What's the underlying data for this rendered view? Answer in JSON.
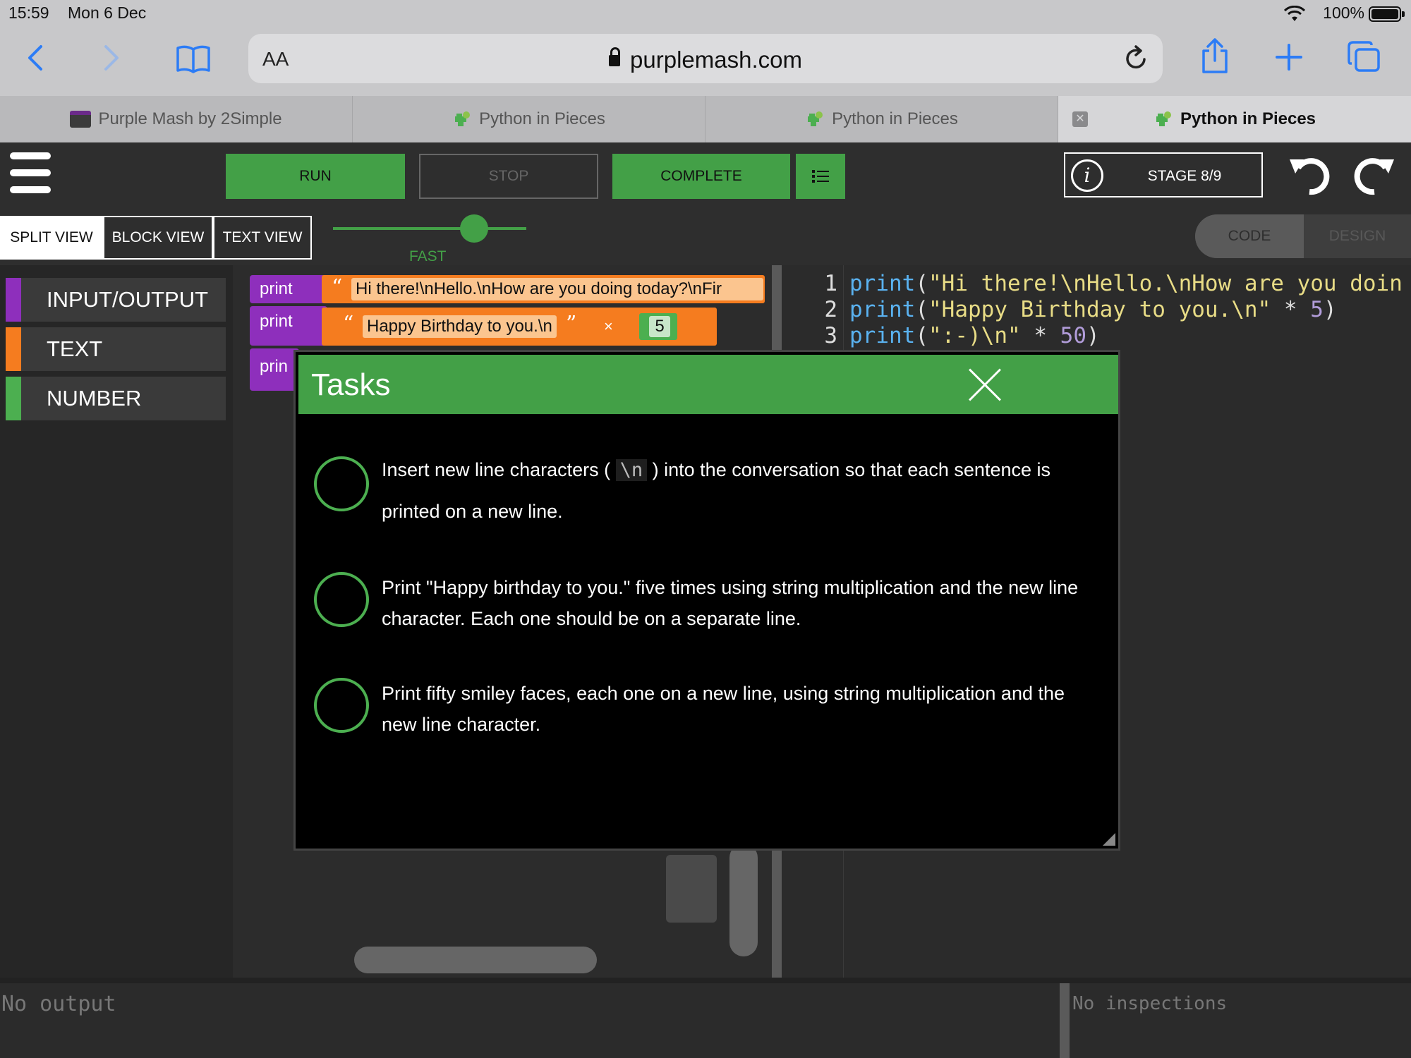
{
  "status_bar": {
    "time": "15:59",
    "date": "Mon 6 Dec",
    "battery": "100%"
  },
  "browser": {
    "url": "purplemash.com",
    "aa_label": "AA",
    "tabs": [
      {
        "label": "Purple Mash by 2Simple"
      },
      {
        "label": "Python in Pieces"
      },
      {
        "label": "Python in Pieces"
      },
      {
        "label": "Python in Pieces"
      }
    ]
  },
  "app": {
    "run": "RUN",
    "stop": "STOP",
    "complete": "COMPLETE",
    "stage": "STAGE 8/9",
    "views": {
      "split": "SPLIT VIEW",
      "block": "BLOCK VIEW",
      "text": "TEXT VIEW"
    },
    "speed": "FAST",
    "speed_level": 0.73,
    "mode": {
      "code": "CODE",
      "design": "DESIGN"
    },
    "categories": [
      {
        "label": "INPUT/OUTPUT",
        "color": "#8e2fbc"
      },
      {
        "label": "TEXT",
        "color": "#f57c1f"
      },
      {
        "label": "NUMBER",
        "color": "#4caf50"
      }
    ],
    "blocks": {
      "print1_label": "print",
      "print1_text": "Hi there!\\nHello.\\nHow are you doing today?\\nFir",
      "print2_label": "print",
      "print2_text": "Happy Birthday to you.\\n",
      "print2_op": "×",
      "print2_num": "5",
      "print3_label": "prin"
    },
    "code": {
      "lines": [
        {
          "n": "1",
          "fn": "print",
          "open": "(",
          "str": "\"Hi there!\\nHello.\\nHow are you doin",
          "rest": ""
        },
        {
          "n": "2",
          "fn": "print",
          "open": "(",
          "str": "\"Happy Birthday to you.\\n\"",
          "op": " * ",
          "num": "5",
          "close": ")"
        },
        {
          "n": "3",
          "fn": "print",
          "open": "(",
          "str": "\":-)\\n\"",
          "op": " * ",
          "num": "50",
          "close": ")"
        }
      ]
    },
    "output": "No output",
    "inspections": "No inspections"
  },
  "modal": {
    "title": "Tasks",
    "tasks": [
      {
        "before": "Insert new line characters ( ",
        "code": "\\n",
        "after": " ) into the conversation so that each sentence is printed on a new line."
      },
      {
        "text": "Print \"Happy birthday to you.\" five times using string multiplication and the new line character. Each one should be on a separate line."
      },
      {
        "text": "Print fifty smiley faces, each one on a new line, using string multiplication and the new line character."
      }
    ]
  },
  "colors": {
    "accent_green": "#43a047",
    "purple": "#8e2fbc",
    "orange": "#f57c1f",
    "ios_blue": "#2c7cf6"
  },
  "icons": [
    "back-icon",
    "forward-icon",
    "bookmarks-icon",
    "lock-icon",
    "reload-icon",
    "share-icon",
    "new-tab-icon",
    "tabs-icon",
    "menu-icon",
    "task-list-icon",
    "info-icon",
    "undo-icon",
    "redo-icon",
    "close-icon"
  ]
}
